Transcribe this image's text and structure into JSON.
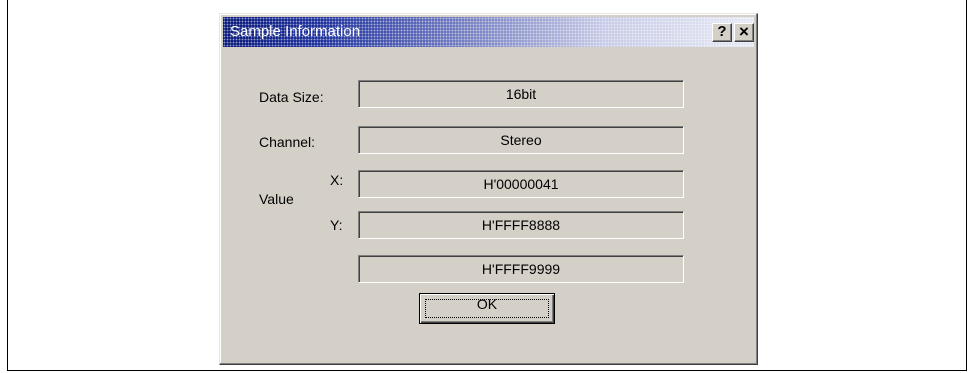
{
  "window": {
    "title": "Sample Information",
    "help_label": "?",
    "close_label": "×"
  },
  "fields": {
    "data_size": {
      "label": "Data Size:",
      "value": "16bit"
    },
    "channel": {
      "label": "Channel:",
      "value": "Stereo"
    },
    "value_group_label": "Value",
    "x": {
      "label": "X:",
      "value": "H'00000041"
    },
    "y": {
      "label": "Y:",
      "value": "H'FFFF8888"
    },
    "extra": {
      "value": "H'FFFF9999"
    }
  },
  "buttons": {
    "ok_label": "OK"
  },
  "colors": {
    "dialog_face": "#d4d0c8",
    "title_start": "#0a1a7a",
    "title_end": "#e6e8f4"
  }
}
